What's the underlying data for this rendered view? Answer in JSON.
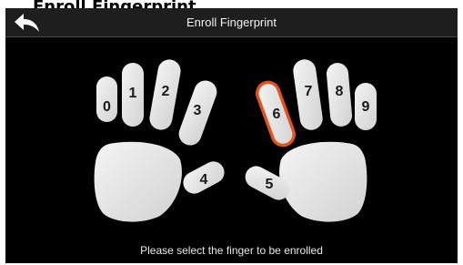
{
  "page": {
    "caption": "Enroll Fingerprint"
  },
  "header": {
    "title": "Enroll Fingerprint",
    "back_icon": "back-arrow-icon"
  },
  "fingers": [
    {
      "id": 0,
      "label": "0",
      "selected": false
    },
    {
      "id": 1,
      "label": "1",
      "selected": false
    },
    {
      "id": 2,
      "label": "2",
      "selected": false
    },
    {
      "id": 3,
      "label": "3",
      "selected": false
    },
    {
      "id": 4,
      "label": "4",
      "selected": false
    },
    {
      "id": 5,
      "label": "5",
      "selected": false
    },
    {
      "id": 6,
      "label": "6",
      "selected": true
    },
    {
      "id": 7,
      "label": "7",
      "selected": false
    },
    {
      "id": 8,
      "label": "8",
      "selected": false
    },
    {
      "id": 9,
      "label": "9",
      "selected": false
    }
  ],
  "prompt": "Please select the finger to be enrolled",
  "colors": {
    "finger_fill": "#e6e6e6",
    "selected_outline": "#e2531c",
    "screen_bg": "#000000",
    "header_bg": "#1e1e1e"
  }
}
